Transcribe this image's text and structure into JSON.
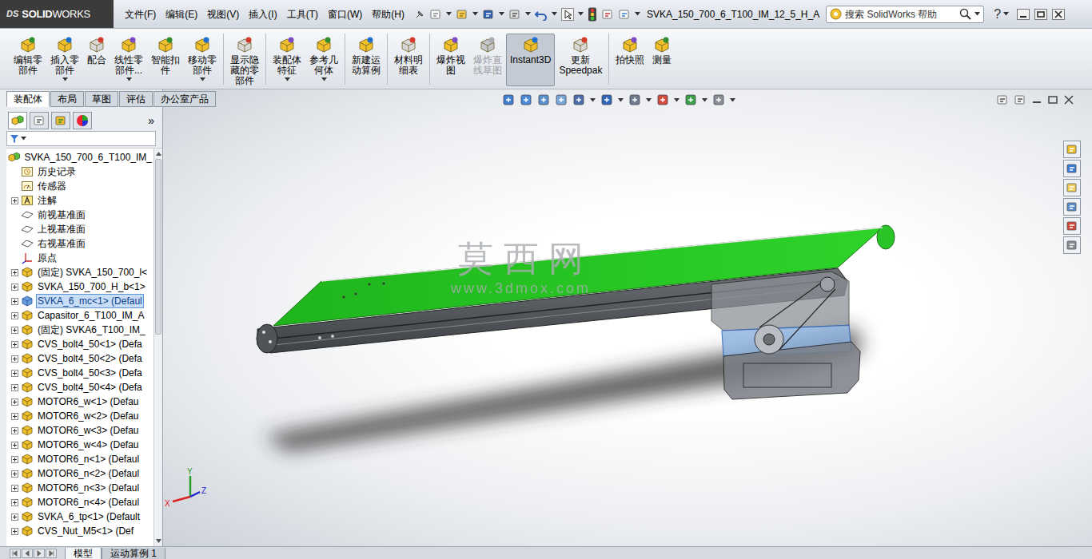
{
  "logo": {
    "mark": "DS",
    "solid": "SOLID",
    "works": "WORKS"
  },
  "menu": [
    "文件(F)",
    "编辑(E)",
    "视图(V)",
    "插入(I)",
    "工具(T)",
    "窗口(W)",
    "帮助(H)"
  ],
  "document_title": "SVKA_150_700_6_T100_IM_12_5_H_A",
  "search": {
    "placeholder": "搜索 SolidWorks 帮助"
  },
  "help_glyph": "?",
  "commands": [
    {
      "lines": [
        "编辑零",
        "部件"
      ],
      "dropdown": false,
      "disabled": false,
      "selected": false,
      "separator_after": false
    },
    {
      "lines": [
        "插入零",
        "部件"
      ],
      "dropdown": true,
      "disabled": false,
      "selected": false,
      "separator_after": false
    },
    {
      "lines": [
        "配合"
      ],
      "dropdown": false,
      "disabled": false,
      "selected": false,
      "separator_after": false
    },
    {
      "lines": [
        "线性零",
        "部件..."
      ],
      "dropdown": true,
      "disabled": false,
      "selected": false,
      "separator_after": false
    },
    {
      "lines": [
        "智能扣",
        "件"
      ],
      "dropdown": false,
      "disabled": false,
      "selected": false,
      "separator_after": false
    },
    {
      "lines": [
        "移动零",
        "部件"
      ],
      "dropdown": true,
      "disabled": false,
      "selected": false,
      "separator_after": true
    },
    {
      "lines": [
        "显示隐",
        "藏的零",
        "部件"
      ],
      "dropdown": false,
      "disabled": false,
      "selected": false,
      "separator_after": true
    },
    {
      "lines": [
        "装配体",
        "特征"
      ],
      "dropdown": true,
      "disabled": false,
      "selected": false,
      "separator_after": false
    },
    {
      "lines": [
        "参考几",
        "何体"
      ],
      "dropdown": true,
      "disabled": false,
      "selected": false,
      "separator_after": true
    },
    {
      "lines": [
        "新建运",
        "动算例"
      ],
      "dropdown": false,
      "disabled": false,
      "selected": false,
      "separator_after": true
    },
    {
      "lines": [
        "材料明",
        "细表"
      ],
      "dropdown": false,
      "disabled": false,
      "selected": false,
      "separator_after": true
    },
    {
      "lines": [
        "爆炸视",
        "图"
      ],
      "dropdown": false,
      "disabled": false,
      "selected": false,
      "separator_after": false
    },
    {
      "lines": [
        "爆炸直",
        "线草图"
      ],
      "dropdown": false,
      "disabled": true,
      "selected": false,
      "separator_after": false
    },
    {
      "lines": [
        "Instant3D"
      ],
      "dropdown": false,
      "disabled": false,
      "selected": true,
      "separator_after": false
    },
    {
      "lines": [
        "更新",
        "Speedpak"
      ],
      "dropdown": false,
      "disabled": false,
      "selected": false,
      "separator_after": true
    },
    {
      "lines": [
        "拍快照"
      ],
      "dropdown": false,
      "disabled": false,
      "selected": false,
      "separator_after": false
    },
    {
      "lines": [
        "测量"
      ],
      "dropdown": false,
      "disabled": false,
      "selected": false,
      "separator_after": false
    }
  ],
  "command_tabs": [
    {
      "label": "装配体",
      "selected": true
    },
    {
      "label": "布局",
      "selected": false
    },
    {
      "label": "草图",
      "selected": false
    },
    {
      "label": "评估",
      "selected": false
    },
    {
      "label": "办公室产品",
      "selected": false
    }
  ],
  "panel_more": "»",
  "tree": {
    "items": [
      {
        "label": "SVKA_150_700_6_T100_IM_",
        "kind": "assembly",
        "level": 0,
        "expandable": false,
        "selected": false
      },
      {
        "label": "历史记录",
        "kind": "history",
        "level": 1,
        "expandable": false,
        "selected": false
      },
      {
        "label": "传感器",
        "kind": "sensor",
        "level": 1,
        "expandable": false,
        "selected": false
      },
      {
        "label": "注解",
        "kind": "annotation",
        "level": 1,
        "expandable": true,
        "selected": false
      },
      {
        "label": "前视基准面",
        "kind": "plane",
        "level": 1,
        "expandable": false,
        "selected": false
      },
      {
        "label": "上视基准面",
        "kind": "plane",
        "level": 1,
        "expandable": false,
        "selected": false
      },
      {
        "label": "右视基准面",
        "kind": "plane",
        "level": 1,
        "expandable": false,
        "selected": false
      },
      {
        "label": "原点",
        "kind": "origin",
        "level": 1,
        "expandable": false,
        "selected": false
      },
      {
        "label": "(固定) SVKA_150_700_l<",
        "kind": "part",
        "level": 1,
        "expandable": true,
        "selected": false
      },
      {
        "label": "SVKA_150_700_H_b<1>",
        "kind": "part",
        "level": 1,
        "expandable": true,
        "selected": false
      },
      {
        "label": "SVKA_6_mc<1> (Defaul",
        "kind": "part",
        "level": 1,
        "expandable": true,
        "selected": true
      },
      {
        "label": "Capasitor_6_T100_IM_A",
        "kind": "part",
        "level": 1,
        "expandable": true,
        "selected": false
      },
      {
        "label": "(固定) SVKA6_T100_IM_",
        "kind": "part",
        "level": 1,
        "expandable": true,
        "selected": false
      },
      {
        "label": "CVS_bolt4_50<1> (Defa",
        "kind": "part",
        "level": 1,
        "expandable": true,
        "selected": false
      },
      {
        "label": "CVS_bolt4_50<2> (Defa",
        "kind": "part",
        "level": 1,
        "expandable": true,
        "selected": false
      },
      {
        "label": "CVS_bolt4_50<3> (Defa",
        "kind": "part",
        "level": 1,
        "expandable": true,
        "selected": false
      },
      {
        "label": "CVS_bolt4_50<4> (Defa",
        "kind": "part",
        "level": 1,
        "expandable": true,
        "selected": false
      },
      {
        "label": "MOTOR6_w<1> (Defau",
        "kind": "part",
        "level": 1,
        "expandable": true,
        "selected": false
      },
      {
        "label": "MOTOR6_w<2> (Defau",
        "kind": "part",
        "level": 1,
        "expandable": true,
        "selected": false
      },
      {
        "label": "MOTOR6_w<3> (Defau",
        "kind": "part",
        "level": 1,
        "expandable": true,
        "selected": false
      },
      {
        "label": "MOTOR6_w<4> (Defau",
        "kind": "part",
        "level": 1,
        "expandable": true,
        "selected": false
      },
      {
        "label": "MOTOR6_n<1> (Defaul",
        "kind": "part",
        "level": 1,
        "expandable": true,
        "selected": false
      },
      {
        "label": "MOTOR6_n<2> (Defaul",
        "kind": "part",
        "level": 1,
        "expandable": true,
        "selected": false
      },
      {
        "label": "MOTOR6_n<3> (Defaul",
        "kind": "part",
        "level": 1,
        "expandable": true,
        "selected": false
      },
      {
        "label": "MOTOR6_n<4> (Defaul",
        "kind": "part",
        "level": 1,
        "expandable": true,
        "selected": false
      },
      {
        "label": "SVKA_6_tp<1> (Default",
        "kind": "part",
        "level": 1,
        "expandable": true,
        "selected": false
      },
      {
        "label": "CVS_Nut_M5<1> (Def",
        "kind": "part",
        "level": 1,
        "expandable": true,
        "selected": false
      }
    ]
  },
  "watermark": {
    "title": "莫 西 网",
    "url": "www.3dmox.com"
  },
  "triad": {
    "x": "X",
    "y": "Y",
    "z": "Z"
  },
  "bottom_tabs": [
    {
      "label": "模型",
      "selected": true
    },
    {
      "label": "运动算例 1",
      "selected": false
    }
  ]
}
